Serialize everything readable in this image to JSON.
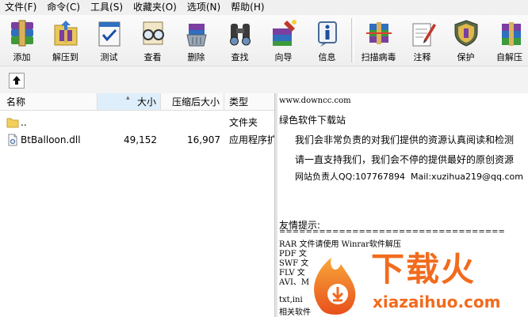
{
  "menu": [
    {
      "label": "文件(F)"
    },
    {
      "label": "命令(C)"
    },
    {
      "label": "工具(S)"
    },
    {
      "label": "收藏夹(O)"
    },
    {
      "label": "选项(N)"
    },
    {
      "label": "帮助(H)"
    }
  ],
  "toolbar": {
    "add": "添加",
    "extract": "解压到",
    "test": "测试",
    "view": "查看",
    "delete": "删除",
    "find": "查找",
    "wizard": "向导",
    "info": "信息",
    "scan": "扫描病毒",
    "comment": "注释",
    "protect": "保护",
    "sfx": "自解压"
  },
  "columns": {
    "name": "名称",
    "size": "大小",
    "packed": "压缩后大小",
    "type": "类型"
  },
  "files": [
    {
      "name": "..",
      "size": "",
      "packed": "",
      "type": "文件夹",
      "icon": "folder-icon"
    },
    {
      "name": "BtBalloon.dll",
      "size": "49,152",
      "packed": "16,907",
      "type": "应用程序扩展",
      "icon": "dll-file-icon"
    }
  ],
  "comment": {
    "url": "www.downcc.com",
    "site": "绿色软件下载站",
    "line1": "我们会非常负责的对我们提供的资源认真阅读和检测",
    "line2": "请一直支持我们，我们会不停的提供最好的原创资源",
    "line3": "网站负责人QQ:107767894  Mail:xuzihua219@qq.com",
    "tips_title": "友情提示:",
    "divider": "==================================",
    "tip1": "RAR 文件请使用 Winrar软件解压",
    "tip2": "PDF 文",
    "tip3": "SWF 文",
    "tip4": "FLV 文",
    "tip5": "AVI、M",
    "tip6": "txt,ini",
    "tip7": "相关软件"
  },
  "watermark": {
    "brand": "下载火",
    "domain": "xiazaihuo.com"
  },
  "colors": {
    "watermark_orange": "#f26b1d",
    "header_sorted": "#deeffb"
  }
}
